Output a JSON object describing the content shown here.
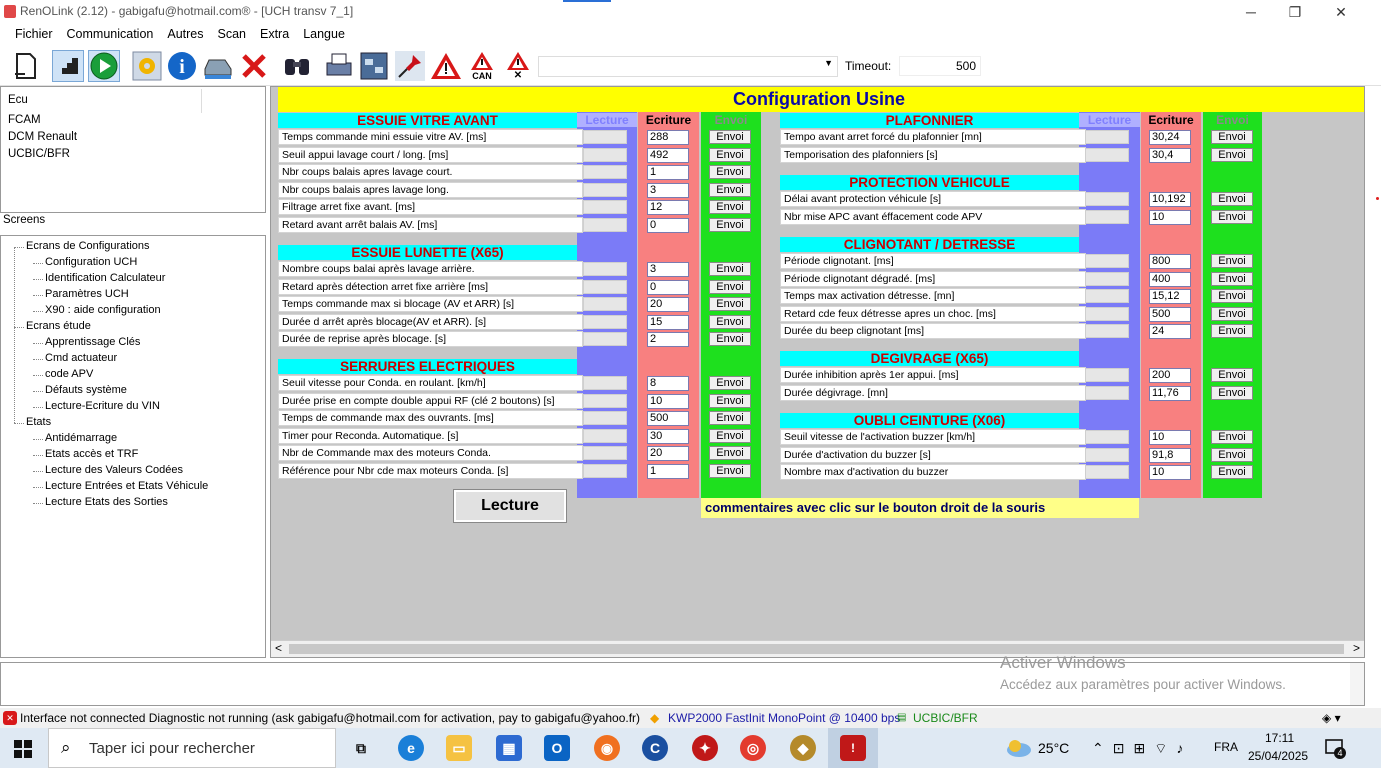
{
  "window": {
    "title": "RenOLink (2.12) - gabigafu@hotmail.com® -  [UCH transv 7_1]"
  },
  "menu": [
    "Fichier",
    "Communication",
    "Autres",
    "Scan",
    "Extra",
    "Langue"
  ],
  "toolbar": {
    "timeout_label": "Timeout:",
    "timeout_value": "500",
    "can_label": "CAN"
  },
  "ecu_list": {
    "header": "Ecu",
    "items": [
      "FCAM",
      "DCM Renault",
      "UCBIC/BFR"
    ]
  },
  "screens_label": "Screens",
  "tree": [
    {
      "label": "Ecrans de Configurations",
      "level": 1
    },
    {
      "label": "Configuration UCH",
      "level": 2
    },
    {
      "label": "Identification Calculateur",
      "level": 2
    },
    {
      "label": "Paramètres UCH",
      "level": 2
    },
    {
      "label": "X90 : aide configuration",
      "level": 2
    },
    {
      "label": "Ecrans étude",
      "level": 1
    },
    {
      "label": "Apprentissage Clés",
      "level": 2
    },
    {
      "label": "Cmd actuateur",
      "level": 2
    },
    {
      "label": "code APV",
      "level": 2
    },
    {
      "label": "Défauts système",
      "level": 2
    },
    {
      "label": "Lecture-Ecriture du VIN",
      "level": 2
    },
    {
      "label": "Etats",
      "level": 1
    },
    {
      "label": "Antidémarrage",
      "level": 2
    },
    {
      "label": "Etats accès et TRF",
      "level": 2
    },
    {
      "label": "Lecture des Valeurs Codées",
      "level": 2
    },
    {
      "label": "Lecture Entrées et Etats Véhicule",
      "level": 2
    },
    {
      "label": "Lecture Etats des Sorties",
      "level": 2
    }
  ],
  "page": {
    "title": "Configuration Usine",
    "col_lecture": "Lecture",
    "col_ecriture": "Ecriture",
    "col_envoi": "Envoi",
    "envoi_label": "Envoi",
    "lecture_button": "Lecture",
    "comment": "commentaires avec clic sur le bouton droit de la souris",
    "left_sections": [
      {
        "title": "ESSUIE VITRE AVANT",
        "rows": [
          {
            "label": "Temps commande mini essuie vitre AV. [ms]",
            "value": "288"
          },
          {
            "label": "Seuil appui lavage court / long. [ms]",
            "value": "492"
          },
          {
            "label": "Nbr coups balais apres lavage court.",
            "value": "1"
          },
          {
            "label": "Nbr coups balais apres lavage long.",
            "value": "3"
          },
          {
            "label": "Filtrage arret fixe avant. [ms]",
            "value": "12"
          },
          {
            "label": "Retard avant arrêt balais AV. [ms]",
            "value": "0"
          }
        ]
      },
      {
        "title": "ESSUIE LUNETTE (X65)",
        "rows": [
          {
            "label": "Nombre coups balai après lavage arrière.",
            "value": "3"
          },
          {
            "label": "Retard après détection arret fixe arrière [ms]",
            "value": "0"
          },
          {
            "label": "Temps commande max si blocage (AV et ARR) [s]",
            "value": "20"
          },
          {
            "label": "Durée d arrêt après blocage(AV et ARR). [s]",
            "value": "15"
          },
          {
            "label": "Durée de reprise après blocage. [s]",
            "value": "2"
          }
        ]
      },
      {
        "title": "SERRURES ELECTRIQUES",
        "rows": [
          {
            "label": "Seuil vitesse pour Conda. en roulant. [km/h]",
            "value": "8"
          },
          {
            "label": "Durée prise en compte double appui RF (clé 2 boutons) [s]",
            "value": "10"
          },
          {
            "label": "Temps de commande max des ouvrants. [ms]",
            "value": "500"
          },
          {
            "label": "Timer pour Reconda. Automatique. [s]",
            "value": "30"
          },
          {
            "label": "Nbr de Commande max des moteurs Conda.",
            "value": "20"
          },
          {
            "label": "Référence pour Nbr cde max moteurs Conda. [s]",
            "value": "1"
          }
        ]
      }
    ],
    "right_sections": [
      {
        "title": "PLAFONNIER",
        "rows": [
          {
            "label": "Tempo avant arret forcé du plafonnier [mn]",
            "value": "30,24"
          },
          {
            "label": "Temporisation des plafonniers [s]",
            "value": "30,4"
          }
        ]
      },
      {
        "title": "PROTECTION VEHICULE",
        "rows": [
          {
            "label": "Délai avant protection véhicule [s]",
            "value": "10,192"
          },
          {
            "label": "Nbr mise APC avant éffacement code APV",
            "value": "10"
          }
        ]
      },
      {
        "title": "CLIGNOTANT /  DETRESSE",
        "rows": [
          {
            "label": "Période clignotant. [ms]",
            "value": "800"
          },
          {
            "label": "Période clignotant dégradé. [ms]",
            "value": "400"
          },
          {
            "label": "Temps max activation détresse. [mn]",
            "value": "15,12"
          },
          {
            "label": "Retard cde feux détresse apres un choc. [ms]",
            "value": "500"
          },
          {
            "label": "Durée du beep clignotant [ms]",
            "value": "24"
          }
        ]
      },
      {
        "title": "DEGIVRAGE (X65)",
        "rows": [
          {
            "label": "Durée inhibition après 1er appui. [ms]",
            "value": "200"
          },
          {
            "label": "Durée dégivrage. [mn]",
            "value": "11,76"
          }
        ]
      },
      {
        "title": "OUBLI CEINTURE (X06)",
        "rows": [
          {
            "label": "Seuil vitesse de l'activation buzzer [km/h]",
            "value": "10"
          },
          {
            "label": "Durée d'activation du buzzer [s]",
            "value": "91,8"
          },
          {
            "label": "Nombre max d'activation du buzzer",
            "value": "10"
          }
        ]
      }
    ]
  },
  "watermark": {
    "line1": "Activer Windows",
    "line2": "Accédez aux paramètres pour activer Windows."
  },
  "status": {
    "left": "Interface not connected Diagnostic not running (ask gabigafu@hotmail.com for activation, pay to gabigafu@yahoo.fr)",
    "protocol": "KWP2000 FastInit MonoPoint @ 10400 bps",
    "ecu": "UCBIC/BFR"
  },
  "taskbar": {
    "search_placeholder": "Taper ici pour rechercher",
    "weather": "25°C",
    "lang": "FRA",
    "time": "17:11",
    "date": "25/04/2025",
    "notif_count": "4"
  },
  "colors": {
    "header_bg": "#ffff00",
    "section_bg": "#00ffff",
    "section_text": "#cc0000",
    "lecture_col": "#7b7bf7",
    "ecriture_col": "#f88080",
    "envoi_col": "#1ee01e"
  }
}
